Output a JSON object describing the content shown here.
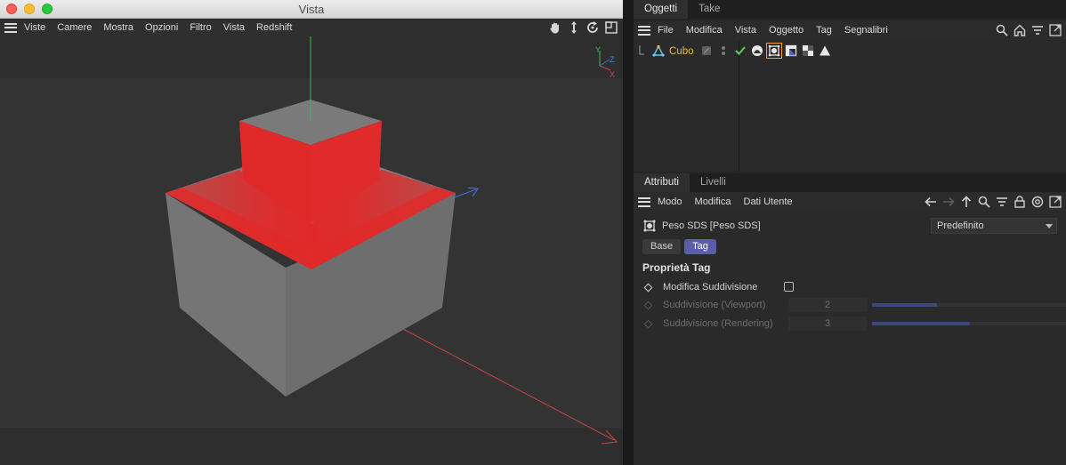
{
  "window": {
    "title": "Vista"
  },
  "viewport": {
    "menu": [
      "Viste",
      "Camere",
      "Mostra",
      "Opzioni",
      "Filtro",
      "Vista",
      "Redshift"
    ],
    "nav_icons": [
      "hand-icon",
      "move-icon",
      "rotate-icon",
      "maximize-icon"
    ],
    "axis_labels": {
      "y": "Y",
      "z": "Z",
      "x": "X"
    },
    "colors": {
      "background": "#2e2e2e",
      "cube_gray": "#787878",
      "highlight_red": "#e02a2a",
      "y_axis": "#3fbf4f",
      "z_axis": "#3a6fdc",
      "x_axis": "#c94545"
    }
  },
  "objects_manager": {
    "tabs": [
      "Oggetti",
      "Take"
    ],
    "active_tab": "Oggetti",
    "menu": [
      "File",
      "Modifica",
      "Vista",
      "Oggetto",
      "Tag",
      "Segnalibri"
    ],
    "icons": [
      "search-icon",
      "home-icon",
      "filter-icon",
      "expand-icon"
    ],
    "objects": [
      {
        "name": "Cubo",
        "icon": "cube-icon",
        "tags": [
          "layer-icon",
          "visibility-dots-icon",
          "enabled-check-icon",
          "material-tag-icon",
          "sds-weight-tag-icon",
          "uvw-tag-icon",
          "checker-tag-icon",
          "phong-tag-icon"
        ]
      }
    ]
  },
  "attributes_manager": {
    "tabs": [
      "Attributi",
      "Livelli"
    ],
    "active_tab": "Attributi",
    "menu": [
      "Modo",
      "Modifica",
      "Dati Utente"
    ],
    "icons": [
      "arrow-left-icon",
      "arrow-right-icon",
      "arrow-up-icon",
      "search-icon",
      "filter-icon",
      "lock-icon",
      "target-icon",
      "expand-icon"
    ],
    "tag_title": "Peso SDS [Peso SDS]",
    "preset": "Predefinito",
    "subtabs": [
      "Base",
      "Tag"
    ],
    "active_subtab": "Tag",
    "section_title": "Proprietà Tag",
    "properties": [
      {
        "label": "Modifica Suddivisione",
        "type": "checkbox",
        "checked": false,
        "enabled": true
      },
      {
        "label": "Suddivisione (Viewport)",
        "type": "number",
        "value": "2",
        "slider_fraction": 0.33,
        "enabled": false
      },
      {
        "label": "Suddivisione (Rendering)",
        "type": "number",
        "value": "3",
        "slider_fraction": 0.5,
        "enabled": false
      }
    ]
  }
}
